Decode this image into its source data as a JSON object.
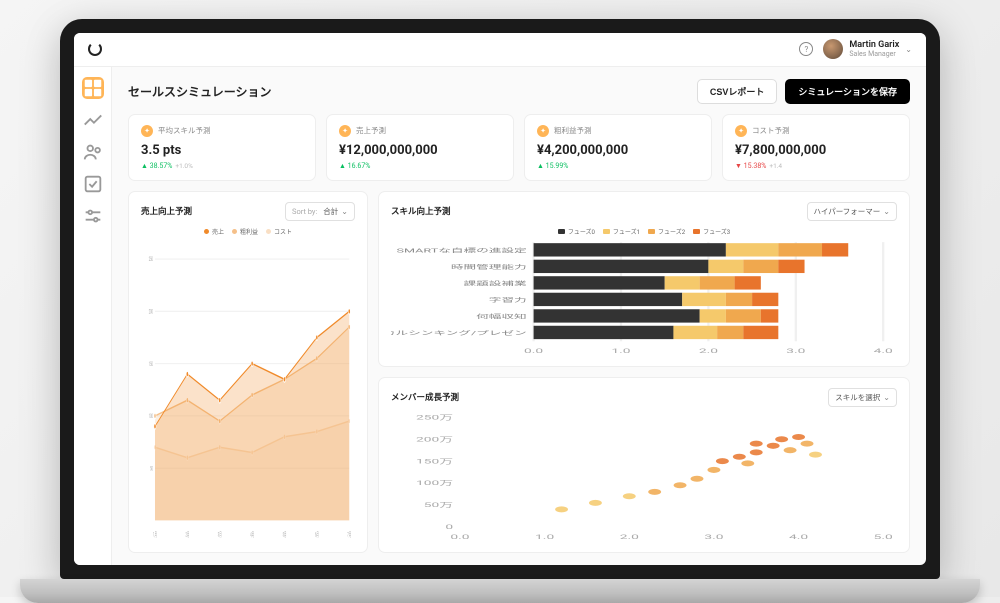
{
  "user": {
    "name": "Martin Garix",
    "role": "Sales Manager"
  },
  "page": {
    "title": "セールスシミュレーション",
    "btn_csv": "CSVレポート",
    "btn_save": "シミュレーションを保存"
  },
  "kpis": [
    {
      "label": "平均スキル予測",
      "value": "3.5 pts",
      "trend": "38.57%",
      "trend_dir": "up",
      "muted": "+1.0%"
    },
    {
      "label": "売上予測",
      "value": "¥12,000,000,000",
      "trend": "16.67%",
      "trend_dir": "up",
      "muted": ""
    },
    {
      "label": "粗利益予測",
      "value": "¥4,200,000,000",
      "trend": "15.99%",
      "trend_dir": "up",
      "muted": ""
    },
    {
      "label": "コスト予測",
      "value": "¥7,800,000,000",
      "trend": "15.38%",
      "trend_dir": "down",
      "muted": "+1.4"
    }
  ],
  "skill_card": {
    "title": "スキル向上予測",
    "dropdown": "ハイパーフォーマー",
    "legend": [
      {
        "label": "フューズ0",
        "color": "#333333"
      },
      {
        "label": "フューズ1",
        "color": "#f5c96b"
      },
      {
        "label": "フューズ2",
        "color": "#f0a84e"
      },
      {
        "label": "フューズ3",
        "color": "#e8742c"
      }
    ]
  },
  "member_card": {
    "title": "メンバー成長予測",
    "dropdown": "スキルを選択"
  },
  "sales_card": {
    "title": "売上向上予測",
    "sort_label": "Sort by:",
    "sort_value": "合計",
    "legend": [
      {
        "label": "売上",
        "color": "#f08a2a"
      },
      {
        "label": "粗利益",
        "color": "#f5c089"
      },
      {
        "label": "コスト",
        "color": "#f9dfc4"
      }
    ]
  },
  "chart_data": [
    {
      "type": "bar",
      "name": "skill_improvement",
      "stacked": true,
      "orientation": "horizontal",
      "xlim": [
        0,
        4.0
      ],
      "xticks": [
        0,
        1.0,
        2.0,
        3.0,
        4.0
      ],
      "categories": [
        "SMARTな自標の進設定",
        "時間管理能力",
        "課題設補業",
        "字習力",
        "何幅収知",
        "ロジカルシンキング/プレゼン"
      ],
      "series": [
        {
          "name": "フューズ0",
          "color": "#333333",
          "values": [
            2.2,
            2.0,
            1.5,
            1.7,
            1.9,
            1.6
          ]
        },
        {
          "name": "フューズ1",
          "color": "#f5c96b",
          "values": [
            0.6,
            0.4,
            0.4,
            0.5,
            0.3,
            0.5
          ]
        },
        {
          "name": "フューズ2",
          "color": "#f0a84e",
          "values": [
            0.5,
            0.4,
            0.4,
            0.3,
            0.4,
            0.3
          ]
        },
        {
          "name": "フューズ3",
          "color": "#e8742c",
          "values": [
            0.3,
            0.3,
            0.3,
            0.3,
            0.2,
            0.4
          ]
        }
      ]
    },
    {
      "type": "scatter",
      "name": "member_growth",
      "xlabel": "",
      "ylabel": "",
      "xlim": [
        0,
        5.0
      ],
      "ylim": [
        0,
        2500000
      ],
      "xticks": [
        0,
        1.0,
        2.0,
        3.0,
        4.0,
        5.0
      ],
      "yticks_labels": [
        "0",
        "50万",
        "100万",
        "150万",
        "200万",
        "250万"
      ],
      "points": [
        {
          "x": 1.2,
          "y": 400000,
          "c": "#f5c96b"
        },
        {
          "x": 1.6,
          "y": 550000,
          "c": "#f5c96b"
        },
        {
          "x": 2.0,
          "y": 700000,
          "c": "#f5c96b"
        },
        {
          "x": 2.3,
          "y": 800000,
          "c": "#f0a84e"
        },
        {
          "x": 2.6,
          "y": 950000,
          "c": "#f0a84e"
        },
        {
          "x": 2.8,
          "y": 1100000,
          "c": "#f0a84e"
        },
        {
          "x": 3.0,
          "y": 1300000,
          "c": "#f0a84e"
        },
        {
          "x": 3.1,
          "y": 1500000,
          "c": "#e8742c"
        },
        {
          "x": 3.3,
          "y": 1600000,
          "c": "#e8742c"
        },
        {
          "x": 3.5,
          "y": 1700000,
          "c": "#e8742c"
        },
        {
          "x": 3.5,
          "y": 1900000,
          "c": "#e8742c"
        },
        {
          "x": 3.7,
          "y": 1850000,
          "c": "#e8742c"
        },
        {
          "x": 3.8,
          "y": 2000000,
          "c": "#e8742c"
        },
        {
          "x": 3.9,
          "y": 1750000,
          "c": "#f0a84e"
        },
        {
          "x": 4.0,
          "y": 2050000,
          "c": "#e8742c"
        },
        {
          "x": 4.1,
          "y": 1900000,
          "c": "#f0a84e"
        },
        {
          "x": 4.2,
          "y": 1650000,
          "c": "#f5c96b"
        },
        {
          "x": 3.4,
          "y": 1450000,
          "c": "#f0a84e"
        }
      ]
    },
    {
      "type": "area",
      "name": "sales_improvement",
      "xticks_labels": [
        "1月",
        "2月",
        "3月",
        "4月",
        "5月",
        "6月",
        "7月"
      ],
      "ylim": [
        0,
        260
      ],
      "yticks": [
        50,
        100,
        150,
        200,
        250
      ],
      "series": [
        {
          "name": "売上",
          "color": "#f08a2a",
          "values": [
            90,
            140,
            115,
            150,
            135,
            175,
            200
          ]
        },
        {
          "name": "粗利益",
          "color": "#f5c089",
          "values": [
            100,
            115,
            95,
            120,
            135,
            155,
            185
          ]
        },
        {
          "name": "コスト",
          "color": "#f9dfc4",
          "values": [
            70,
            60,
            70,
            65,
            80,
            85,
            95
          ]
        }
      ]
    }
  ]
}
